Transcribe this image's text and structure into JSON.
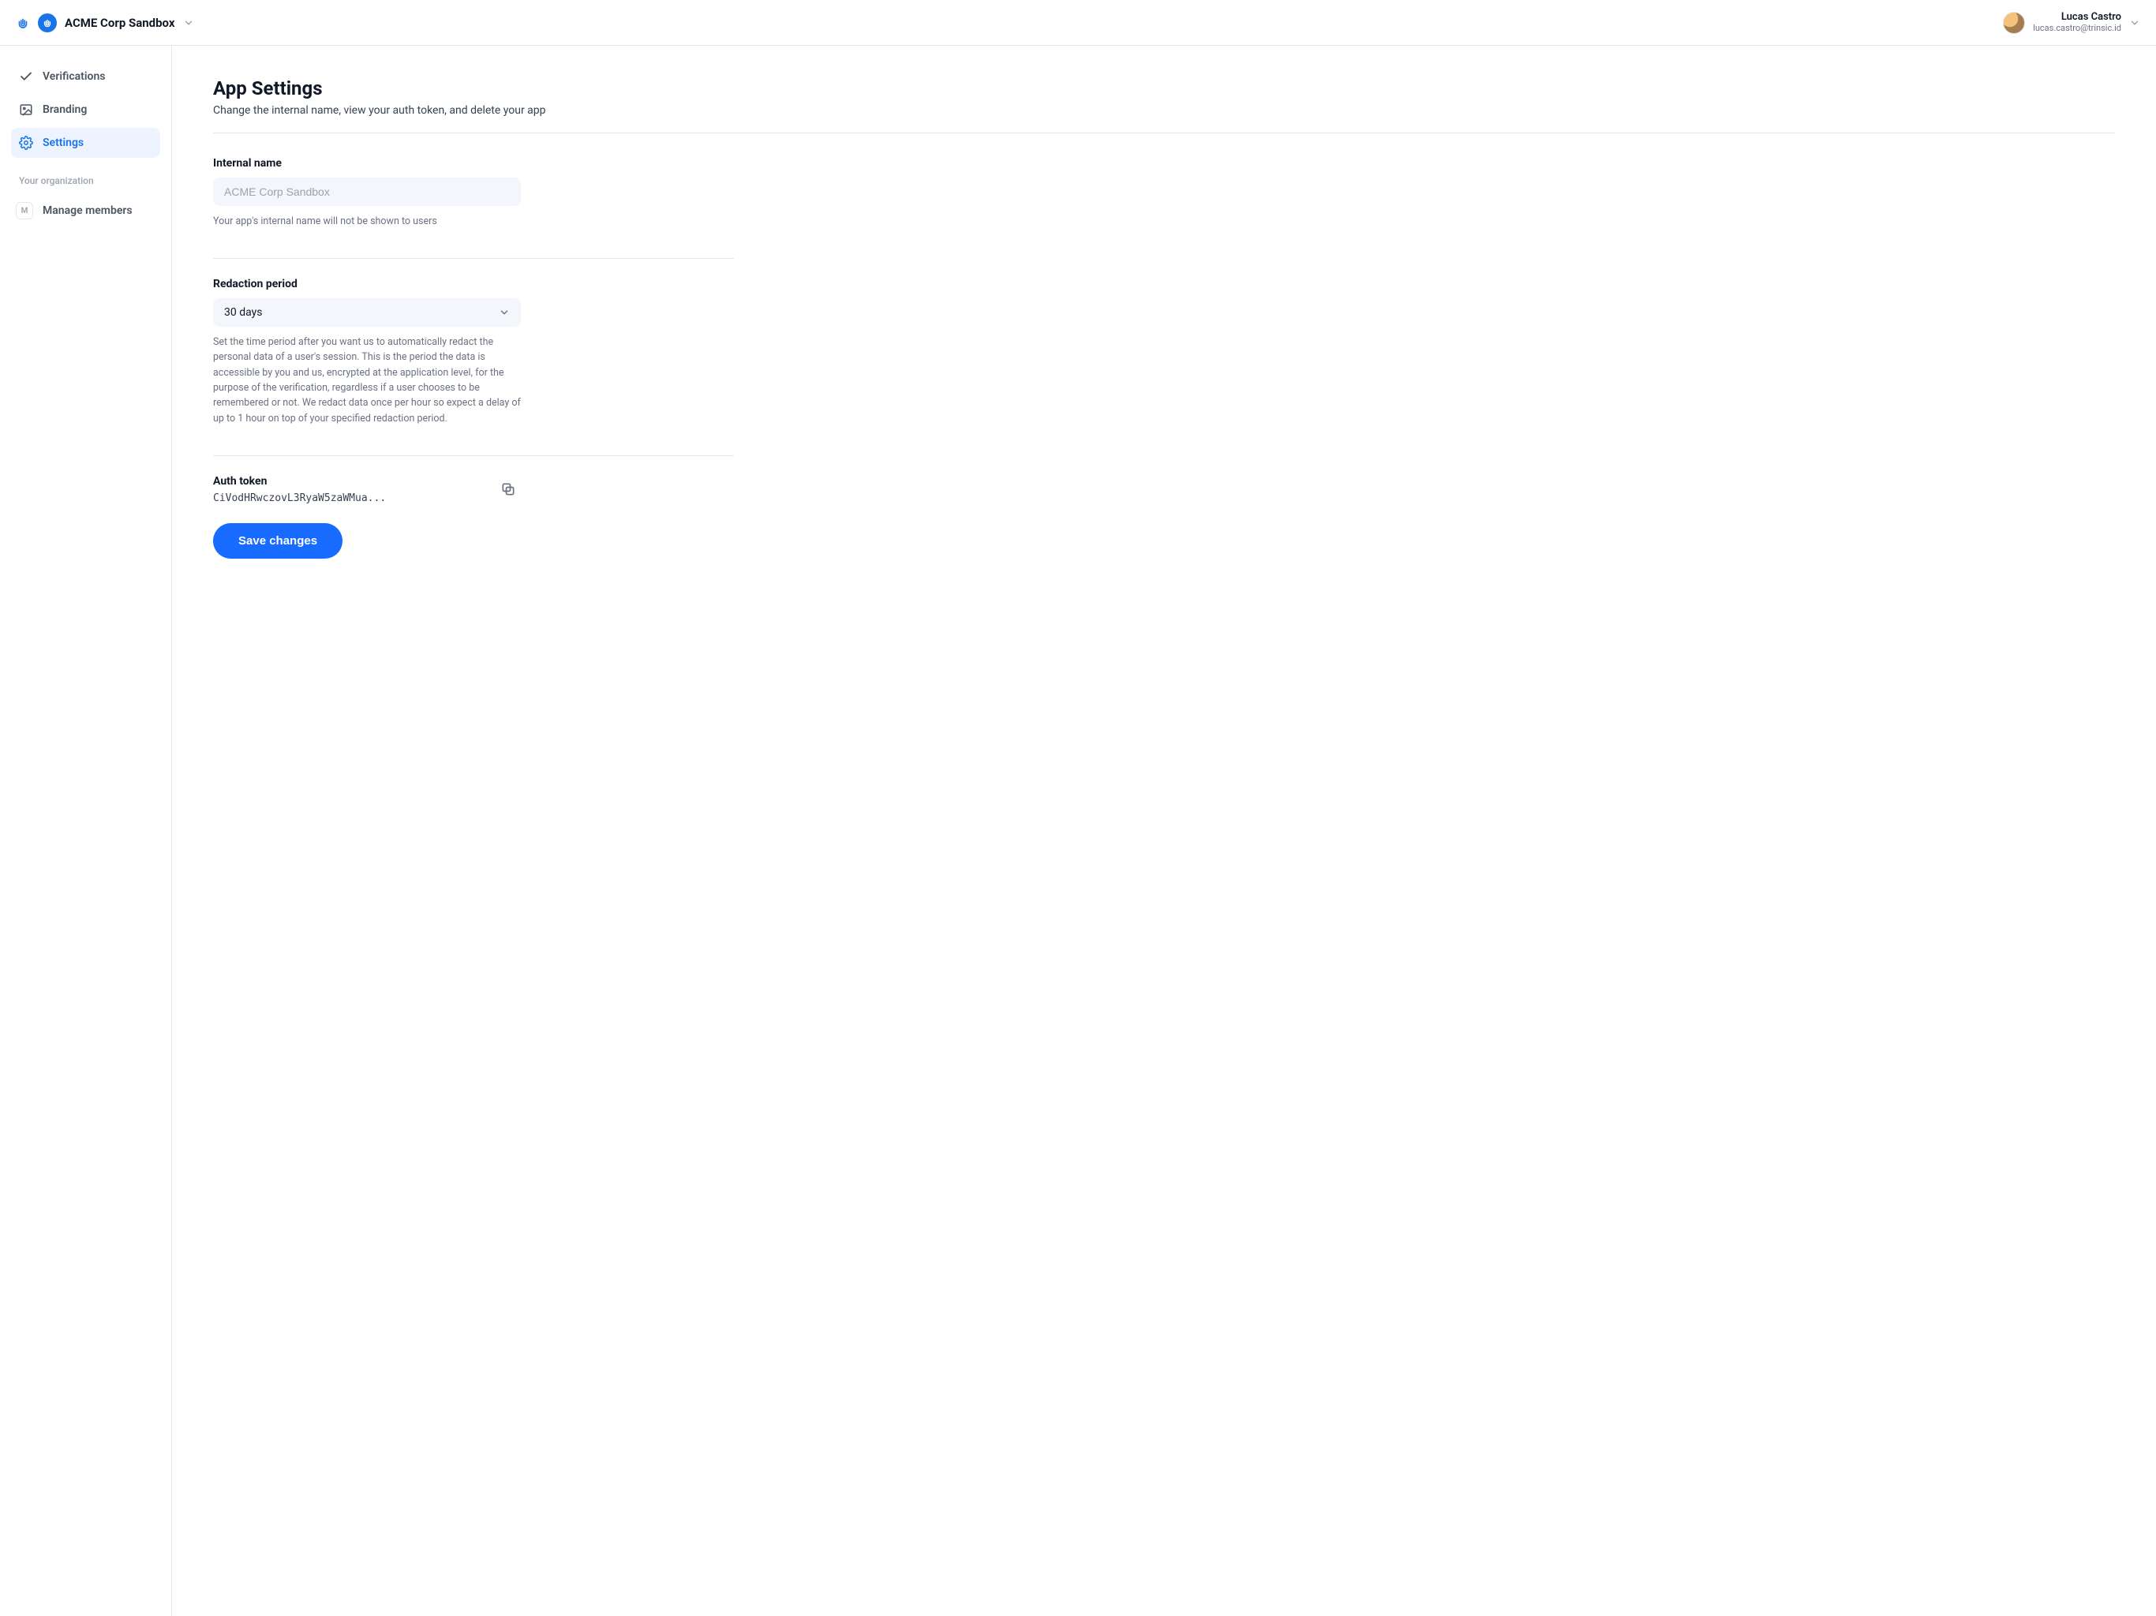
{
  "header": {
    "app_name": "ACME Corp Sandbox",
    "user_name": "Lucas Castro",
    "user_email": "lucas.castro@trinsic.id"
  },
  "sidebar": {
    "items": [
      {
        "label": "Verifications"
      },
      {
        "label": "Branding"
      },
      {
        "label": "Settings"
      }
    ],
    "org_label": "Your organization",
    "manage_label": "Manage members",
    "manage_badge": "M"
  },
  "page": {
    "title": "App Settings",
    "subtitle": "Change the internal name, view your auth token, and delete your app"
  },
  "internal_name": {
    "label": "Internal name",
    "placeholder": "ACME Corp Sandbox",
    "help": "Your app's internal name will not be shown to users"
  },
  "redaction": {
    "label": "Redaction period",
    "value": "30 days",
    "help": "Set the time period after you want us to automatically redact the personal data of a user's session. This is the period the data is accessible by you and us, encrypted at the application level, for the purpose of the verification, regardless if a user chooses to be remembered or not. We redact data once per hour so expect a delay of up to 1 hour on top of your specified redaction period."
  },
  "auth_token": {
    "label": "Auth token",
    "value": "CiVodHRwczovL3RyaW5zaWMua..."
  },
  "actions": {
    "save": "Save changes"
  }
}
